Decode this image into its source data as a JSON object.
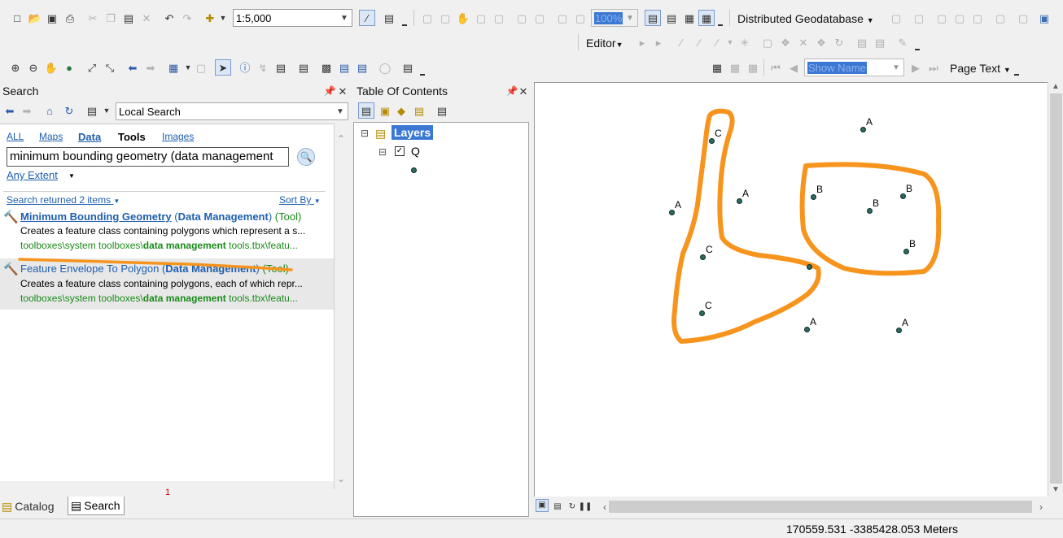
{
  "toolbar_row1": {
    "scale": "1:5,000",
    "zoom_percent": "100%",
    "distributed_geodatabase": "Distributed Geodatabase"
  },
  "toolbar_row2": {
    "editor": "Editor"
  },
  "toolbar_row3": {
    "show_name_placeholder": "Show Name",
    "page_text": "Page Text"
  },
  "search_panel": {
    "title": "Search",
    "scope": "Local Search",
    "filters": [
      "ALL",
      "Maps",
      "Data",
      "Tools",
      "Images"
    ],
    "query": "minimum bounding geometry (data management",
    "extent": "Any Extent",
    "summary": "Search returned 2 items",
    "sort_by": "Sort By",
    "results": [
      {
        "title": "Minimum Bounding Geometry",
        "paren_open": " (",
        "category": "Data Management",
        "paren_close": ")",
        "type": "(Tool)",
        "desc": "Creates a feature class containing polygons which represent a s...",
        "path_pre": "toolboxes\\system toolboxes\\",
        "path_bold": "data management",
        "path_post": " tools.tbx\\featu..."
      },
      {
        "title": "Feature Envelope To Polygon",
        "paren_open": " (",
        "category": "Data Management",
        "paren_close": ")",
        "type": "(Tool)",
        "desc": "Creates a feature class containing polygons, each of which repr...",
        "path_pre": "toolboxes\\system toolboxes\\",
        "path_bold": "data management",
        "path_post": " tools.tbx\\featu..."
      }
    ],
    "tab_catalog": "Catalog",
    "tab_search": "Search",
    "annotation_number": "1"
  },
  "toc": {
    "title": "Table Of Contents",
    "root": "Layers",
    "layer": "Q"
  },
  "map": {
    "points": [
      {
        "label": "C"
      },
      {
        "label": "A"
      },
      {
        "label": "A"
      },
      {
        "label": "A"
      },
      {
        "label": "B"
      },
      {
        "label": "B"
      },
      {
        "label": "B"
      },
      {
        "label": "B"
      },
      {
        "label": "C"
      },
      {
        "label": ""
      },
      {
        "label": "C"
      },
      {
        "label": "A"
      },
      {
        "label": "A"
      }
    ],
    "highlight_color": "#f7941d",
    "point_color": "#2c6b60"
  },
  "status": {
    "coordinates": "170559.531  -3385428.053 Meters"
  }
}
